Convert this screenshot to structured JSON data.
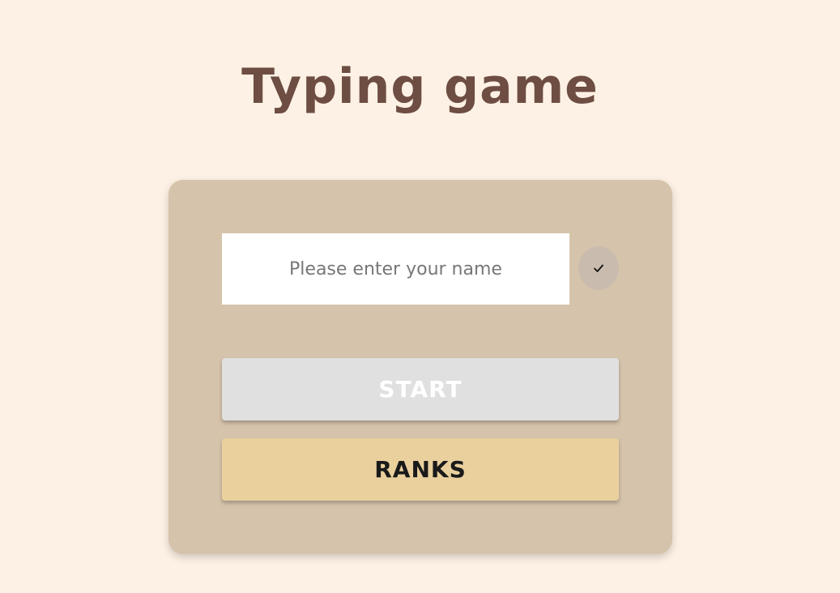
{
  "app": {
    "title": "Typing game"
  },
  "form": {
    "name_placeholder": "Please enter your name",
    "name_value": "",
    "confirm_icon": "check-icon"
  },
  "buttons": {
    "start_label": "START",
    "ranks_label": "RANKS"
  },
  "colors": {
    "background": "#fdf1e5",
    "title": "#6e4d42",
    "card": "#d6c3ab",
    "start_disabled": "#e0e0e0",
    "ranks": "#e9d09d"
  }
}
